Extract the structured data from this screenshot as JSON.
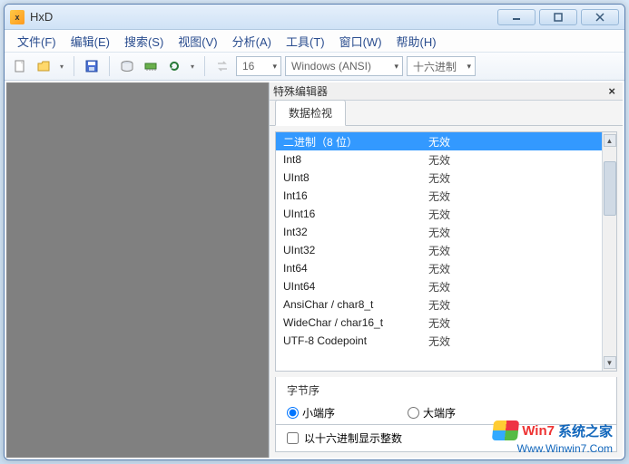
{
  "titlebar": {
    "title": "HxD"
  },
  "menubar": {
    "file": "文件(F)",
    "edit": "编辑(E)",
    "search": "搜索(S)",
    "view": "视图(V)",
    "analyze": "分析(A)",
    "tools": "工具(T)",
    "window": "窗口(W)",
    "help": "帮助(H)"
  },
  "toolbar": {
    "bytes_per_line": "16",
    "encoding": "Windows (ANSI)",
    "base": "十六进制"
  },
  "panel": {
    "title": "特殊编辑器",
    "tab": "数据检视"
  },
  "inspector": {
    "rows": [
      {
        "name": "二进制（8 位）",
        "value": "无效",
        "selected": true
      },
      {
        "name": "Int8",
        "value": "无效"
      },
      {
        "name": "UInt8",
        "value": "无效"
      },
      {
        "name": "Int16",
        "value": "无效"
      },
      {
        "name": "UInt16",
        "value": "无效"
      },
      {
        "name": "Int32",
        "value": "无效"
      },
      {
        "name": "UInt32",
        "value": "无效"
      },
      {
        "name": "Int64",
        "value": "无效"
      },
      {
        "name": "UInt64",
        "value": "无效"
      },
      {
        "name": "AnsiChar / char8_t",
        "value": "无效"
      },
      {
        "name": "WideChar / char16_t",
        "value": "无效"
      },
      {
        "name": "UTF-8 Codepoint",
        "value": "无效"
      }
    ]
  },
  "byteorder": {
    "label": "字节序",
    "little": "小端序",
    "big": "大端序",
    "selected": "little"
  },
  "hexint": {
    "label": "以十六进制显示整数",
    "checked": false
  },
  "watermark": {
    "brand_a": "Win7",
    "brand_b": "系统之家",
    "url": "Www.Winwin7.Com"
  }
}
